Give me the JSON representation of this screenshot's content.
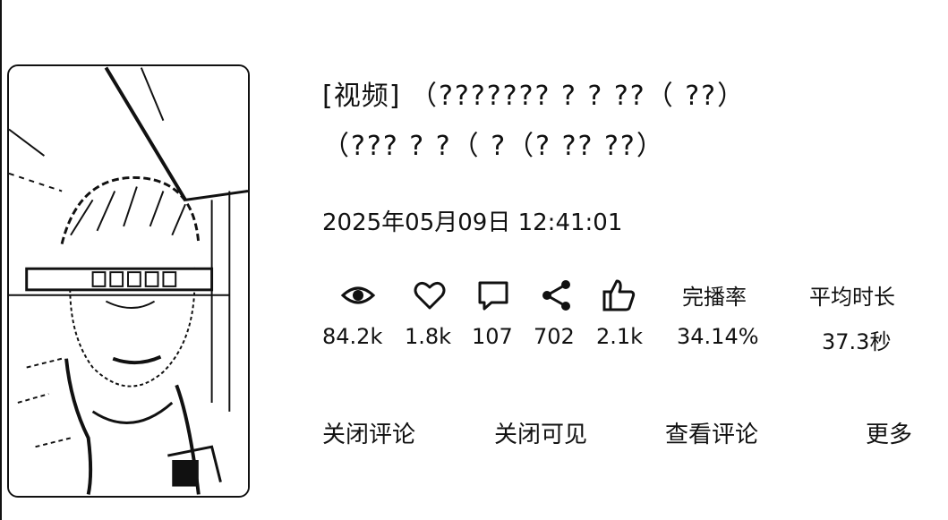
{
  "video": {
    "type_tag": "[视频]",
    "title_line1": "（???????  ?      ?        ??（   ??）",
    "title_line2": "（???  ?      ?（  ?（?  ??          ??）",
    "datetime": "2025年05月09日 12:41:01"
  },
  "stats": {
    "views": "84.2k",
    "likes": "1.8k",
    "comments": "107",
    "shares": "702",
    "recommends": "2.1k",
    "completion_label": "完播率",
    "completion_value": "34.14%",
    "avg_duration_label": "平均时长",
    "avg_duration_value": "37.3秒"
  },
  "icons": {
    "views": "eye-icon",
    "likes": "heart-icon",
    "comments": "comment-icon",
    "shares": "share-icon",
    "recommends": "thumbs-up-icon"
  },
  "actions": {
    "close_comments": "关闭评论",
    "close_visibility": "关闭可见",
    "view_comments": "查看评论",
    "more": "更多"
  }
}
